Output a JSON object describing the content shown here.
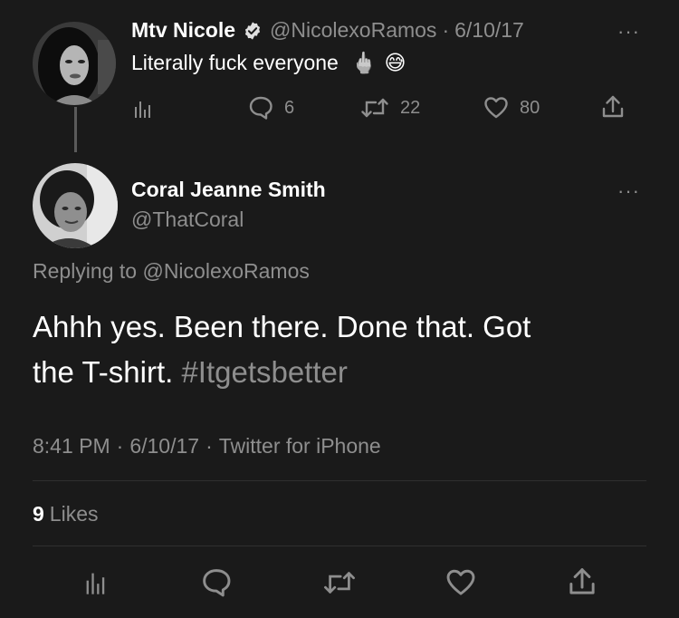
{
  "parent_tweet": {
    "display_name": "Mtv Nicole",
    "verified": true,
    "handle": "@NicolexoRamos",
    "separator": "·",
    "date": "6/10/17",
    "text": "Literally fuck everyone",
    "emoji_1": "🖕",
    "emoji_2": "😅",
    "reply_count": "6",
    "retweet_count": "22",
    "like_count": "80"
  },
  "main_tweet": {
    "display_name": "Coral Jeanne Smith",
    "handle": "@ThatCoral",
    "replying_to_prefix": "Replying to",
    "replying_to_handle": "@NicolexoRamos",
    "text_line_1": "Ahhh yes. Been there. Done that. Got",
    "text_line_2_plain": "the T-shirt. ",
    "hashtag": "#Itgetsbetter",
    "time": "8:41 PM",
    "dot": "·",
    "date": "6/10/17",
    "source": "Twitter for iPhone",
    "likes_count": "9",
    "likes_label": "Likes"
  },
  "icons": {
    "analytics": "analytics-icon",
    "reply": "reply-icon",
    "retweet": "retweet-icon",
    "like": "heart-icon",
    "share": "share-icon",
    "verified": "verified-badge-icon",
    "more": "more-icon"
  },
  "colors": {
    "background": "#1a1a1a",
    "text": "#ffffff",
    "muted": "#8e8e8e",
    "divider": "#2f2f2f"
  }
}
